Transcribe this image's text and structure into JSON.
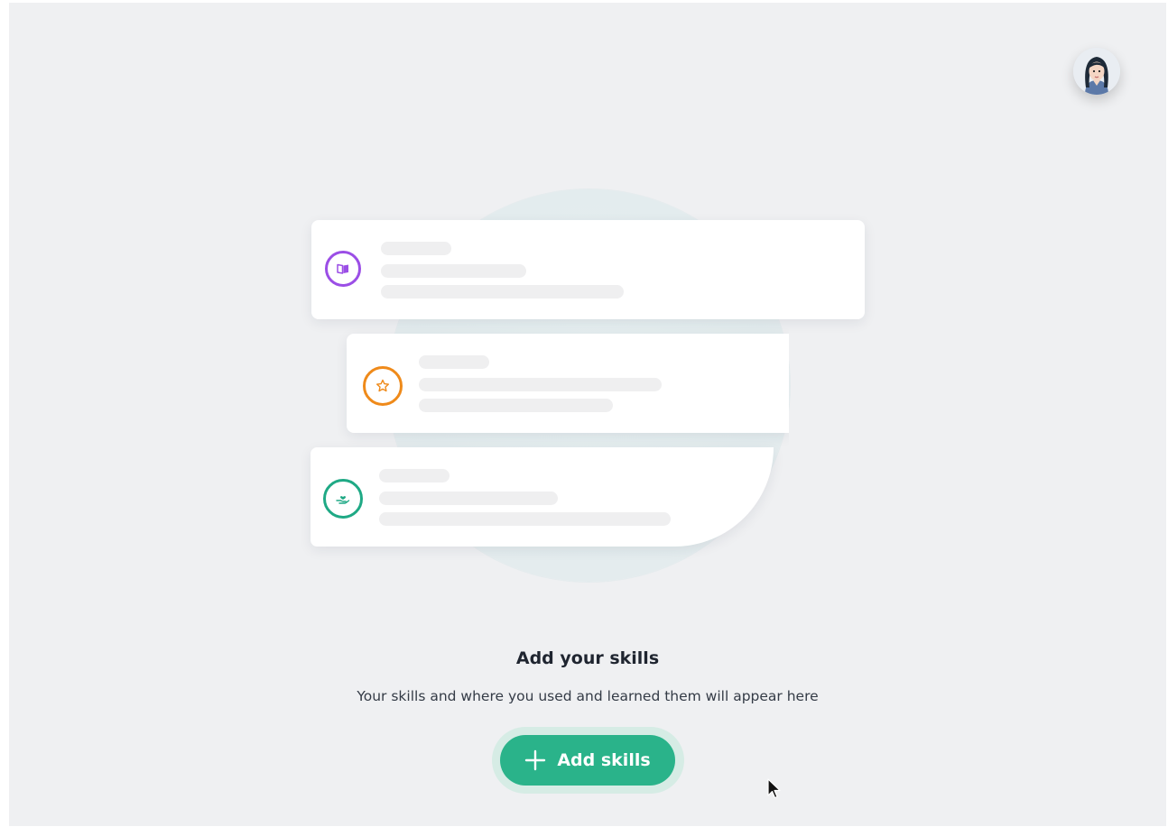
{
  "header": {
    "avatar_icon": "user-avatar"
  },
  "illustration": {
    "cards": [
      {
        "icon": "book-icon",
        "color": "#9b4ee6"
      },
      {
        "icon": "star-icon",
        "color": "#ef8a1a"
      },
      {
        "icon": "hand-heart-icon",
        "color": "#1fa985"
      }
    ]
  },
  "empty_state": {
    "title": "Add your skills",
    "description": "Your skills and where you used and learned them will appear here",
    "button_label": "Add skills",
    "button_icon": "plus-icon",
    "accent": "#2ab38a"
  }
}
